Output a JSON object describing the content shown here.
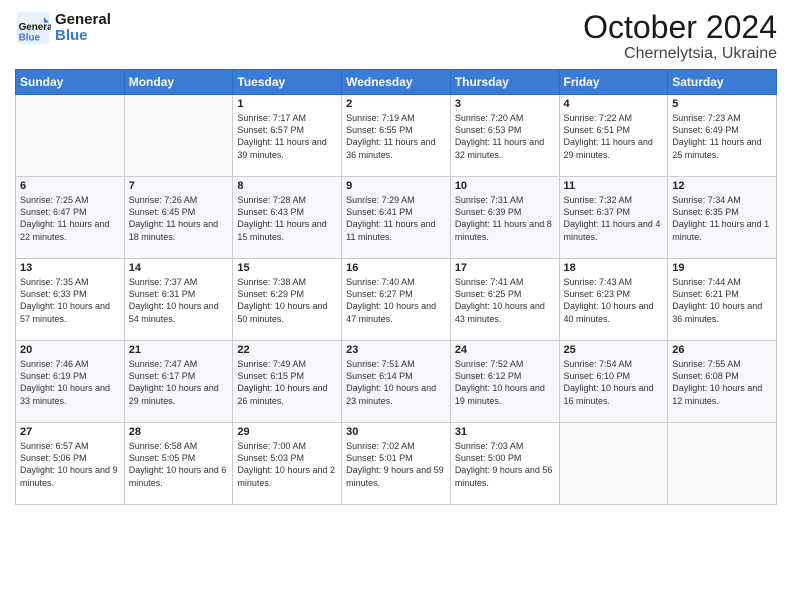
{
  "logo": {
    "line1": "General",
    "line2": "Blue"
  },
  "header": {
    "month_year": "October 2024",
    "location": "Chernelytsia, Ukraine"
  },
  "days_of_week": [
    "Sunday",
    "Monday",
    "Tuesday",
    "Wednesday",
    "Thursday",
    "Friday",
    "Saturday"
  ],
  "weeks": [
    [
      {
        "day": "",
        "content": ""
      },
      {
        "day": "",
        "content": ""
      },
      {
        "day": "1",
        "content": "Sunrise: 7:17 AM\nSunset: 6:57 PM\nDaylight: 11 hours and 39 minutes."
      },
      {
        "day": "2",
        "content": "Sunrise: 7:19 AM\nSunset: 6:55 PM\nDaylight: 11 hours and 36 minutes."
      },
      {
        "day": "3",
        "content": "Sunrise: 7:20 AM\nSunset: 6:53 PM\nDaylight: 11 hours and 32 minutes."
      },
      {
        "day": "4",
        "content": "Sunrise: 7:22 AM\nSunset: 6:51 PM\nDaylight: 11 hours and 29 minutes."
      },
      {
        "day": "5",
        "content": "Sunrise: 7:23 AM\nSunset: 6:49 PM\nDaylight: 11 hours and 25 minutes."
      }
    ],
    [
      {
        "day": "6",
        "content": "Sunrise: 7:25 AM\nSunset: 6:47 PM\nDaylight: 11 hours and 22 minutes."
      },
      {
        "day": "7",
        "content": "Sunrise: 7:26 AM\nSunset: 6:45 PM\nDaylight: 11 hours and 18 minutes."
      },
      {
        "day": "8",
        "content": "Sunrise: 7:28 AM\nSunset: 6:43 PM\nDaylight: 11 hours and 15 minutes."
      },
      {
        "day": "9",
        "content": "Sunrise: 7:29 AM\nSunset: 6:41 PM\nDaylight: 11 hours and 11 minutes."
      },
      {
        "day": "10",
        "content": "Sunrise: 7:31 AM\nSunset: 6:39 PM\nDaylight: 11 hours and 8 minutes."
      },
      {
        "day": "11",
        "content": "Sunrise: 7:32 AM\nSunset: 6:37 PM\nDaylight: 11 hours and 4 minutes."
      },
      {
        "day": "12",
        "content": "Sunrise: 7:34 AM\nSunset: 6:35 PM\nDaylight: 11 hours and 1 minute."
      }
    ],
    [
      {
        "day": "13",
        "content": "Sunrise: 7:35 AM\nSunset: 6:33 PM\nDaylight: 10 hours and 57 minutes."
      },
      {
        "day": "14",
        "content": "Sunrise: 7:37 AM\nSunset: 6:31 PM\nDaylight: 10 hours and 54 minutes."
      },
      {
        "day": "15",
        "content": "Sunrise: 7:38 AM\nSunset: 6:29 PM\nDaylight: 10 hours and 50 minutes."
      },
      {
        "day": "16",
        "content": "Sunrise: 7:40 AM\nSunset: 6:27 PM\nDaylight: 10 hours and 47 minutes."
      },
      {
        "day": "17",
        "content": "Sunrise: 7:41 AM\nSunset: 6:25 PM\nDaylight: 10 hours and 43 minutes."
      },
      {
        "day": "18",
        "content": "Sunrise: 7:43 AM\nSunset: 6:23 PM\nDaylight: 10 hours and 40 minutes."
      },
      {
        "day": "19",
        "content": "Sunrise: 7:44 AM\nSunset: 6:21 PM\nDaylight: 10 hours and 36 minutes."
      }
    ],
    [
      {
        "day": "20",
        "content": "Sunrise: 7:46 AM\nSunset: 6:19 PM\nDaylight: 10 hours and 33 minutes."
      },
      {
        "day": "21",
        "content": "Sunrise: 7:47 AM\nSunset: 6:17 PM\nDaylight: 10 hours and 29 minutes."
      },
      {
        "day": "22",
        "content": "Sunrise: 7:49 AM\nSunset: 6:15 PM\nDaylight: 10 hours and 26 minutes."
      },
      {
        "day": "23",
        "content": "Sunrise: 7:51 AM\nSunset: 6:14 PM\nDaylight: 10 hours and 23 minutes."
      },
      {
        "day": "24",
        "content": "Sunrise: 7:52 AM\nSunset: 6:12 PM\nDaylight: 10 hours and 19 minutes."
      },
      {
        "day": "25",
        "content": "Sunrise: 7:54 AM\nSunset: 6:10 PM\nDaylight: 10 hours and 16 minutes."
      },
      {
        "day": "26",
        "content": "Sunrise: 7:55 AM\nSunset: 6:08 PM\nDaylight: 10 hours and 12 minutes."
      }
    ],
    [
      {
        "day": "27",
        "content": "Sunrise: 6:57 AM\nSunset: 5:06 PM\nDaylight: 10 hours and 9 minutes."
      },
      {
        "day": "28",
        "content": "Sunrise: 6:58 AM\nSunset: 5:05 PM\nDaylight: 10 hours and 6 minutes."
      },
      {
        "day": "29",
        "content": "Sunrise: 7:00 AM\nSunset: 5:03 PM\nDaylight: 10 hours and 2 minutes."
      },
      {
        "day": "30",
        "content": "Sunrise: 7:02 AM\nSunset: 5:01 PM\nDaylight: 9 hours and 59 minutes."
      },
      {
        "day": "31",
        "content": "Sunrise: 7:03 AM\nSunset: 5:00 PM\nDaylight: 9 hours and 56 minutes."
      },
      {
        "day": "",
        "content": ""
      },
      {
        "day": "",
        "content": ""
      }
    ]
  ]
}
